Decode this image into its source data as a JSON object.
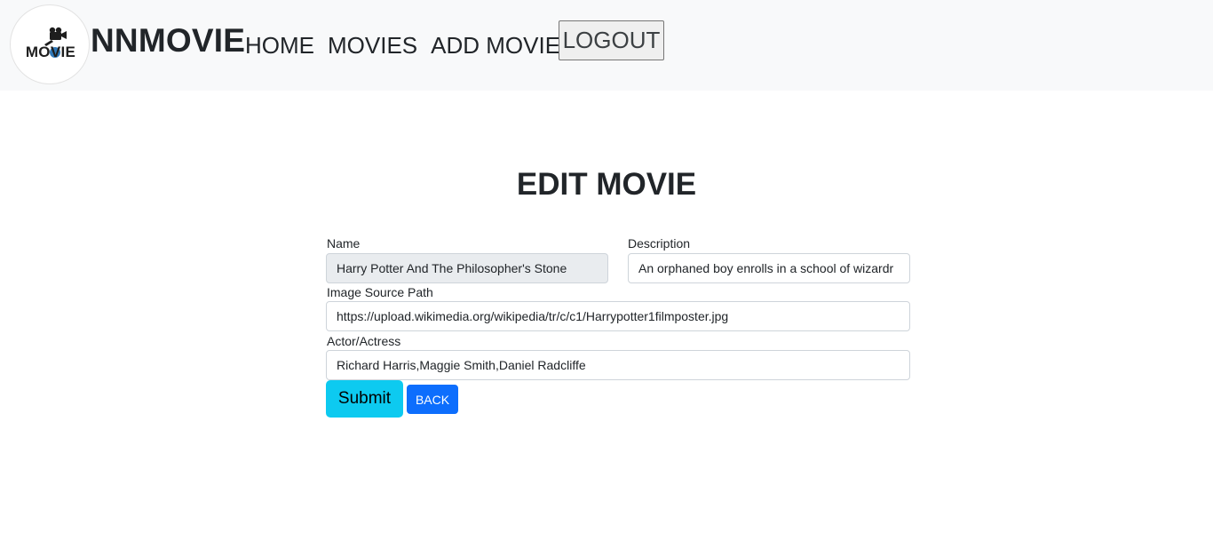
{
  "navbar": {
    "logo_text": "MOVIE",
    "brand": "NNMOVIE",
    "links": [
      "HOME",
      "MOVIES",
      "ADD MOVIE"
    ],
    "logout_label": "LOGOUT"
  },
  "page": {
    "title": "EDIT MOVIE"
  },
  "form": {
    "name": {
      "label": "Name",
      "value": "Harry Potter And The Philosopher's Stone",
      "disabled": true
    },
    "description": {
      "label": "Description",
      "value": "An orphaned boy enrolls in a school of wizardr"
    },
    "image": {
      "label": "Image Source Path",
      "value": "https://upload.wikimedia.org/wikipedia/tr/c/c1/Harrypotter1filmposter.jpg"
    },
    "actors": {
      "label": "Actor/Actress",
      "value": "Richard Harris,Maggie Smith,Daniel Radcliffe"
    },
    "submit_label": "Submit",
    "back_label": "BACK"
  },
  "colors": {
    "navbar_bg": "#f8f9fa",
    "submit_bg": "#0dcaf0",
    "back_bg": "#0d6efd",
    "disabled_bg": "#e9ecef"
  }
}
